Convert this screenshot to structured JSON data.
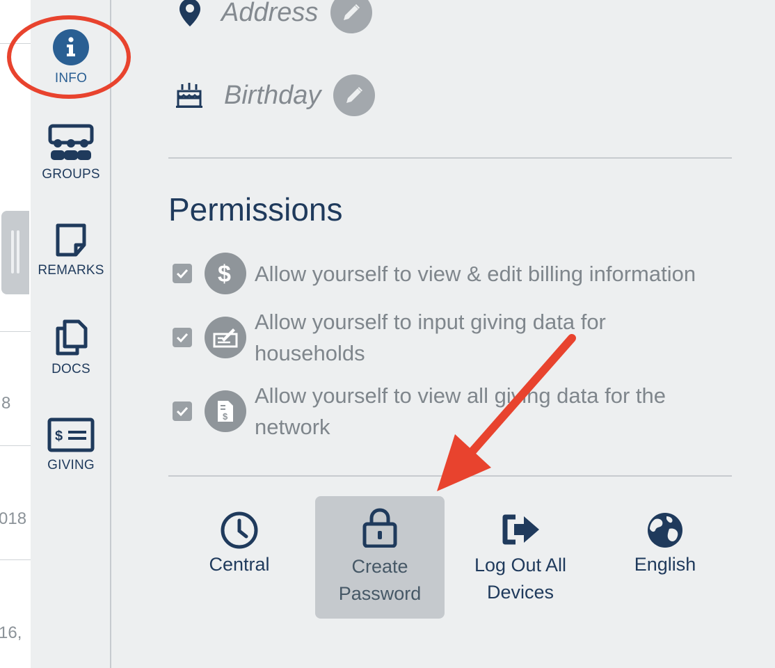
{
  "left_strip": {
    "texts": [
      "8",
      "018",
      "16,"
    ]
  },
  "nav": {
    "items": [
      {
        "label": "INFO",
        "icon": "info-icon",
        "active": true
      },
      {
        "label": "GROUPS",
        "icon": "groups-icon"
      },
      {
        "label": "REMARKS",
        "icon": "remarks-icon"
      },
      {
        "label": "DOCS",
        "icon": "docs-icon"
      },
      {
        "label": "GIVING",
        "icon": "giving-icon"
      }
    ]
  },
  "profile_fields": [
    {
      "label": "Address",
      "icon": "map-pin-icon"
    },
    {
      "label": "Birthday",
      "icon": "birthday-cake-icon"
    }
  ],
  "permissions": {
    "title": "Permissions",
    "items": [
      {
        "text": "Allow yourself to view & edit billing information",
        "icon": "dollar-icon",
        "checked": true
      },
      {
        "text": "Allow yourself to input giving data for households",
        "icon": "check-writing-icon",
        "checked": true
      },
      {
        "text": "Allow yourself to view all giving data for the network",
        "icon": "invoice-icon",
        "checked": true
      }
    ]
  },
  "actions": [
    {
      "label": "Central",
      "icon": "clock-icon"
    },
    {
      "label": "Create Password",
      "icon": "lock-icon",
      "highlighted": true
    },
    {
      "label": "Log Out All Devices",
      "icon": "sign-out-icon"
    },
    {
      "label": "English",
      "icon": "globe-icon"
    }
  ],
  "colors": {
    "accent": "#1f3a5c",
    "active_nav": "#2a5f93",
    "highlight_annotation": "#e8432e",
    "muted_text": "#7f868c",
    "background": "#edeff0"
  }
}
